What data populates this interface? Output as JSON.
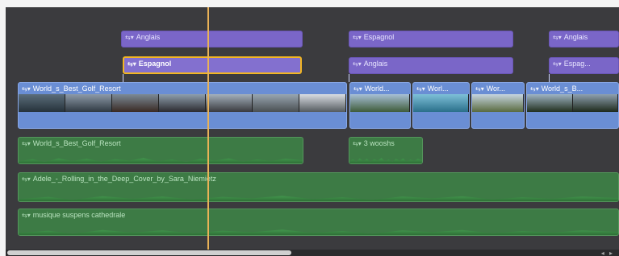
{
  "timeline": {
    "title_clips_row1": [
      {
        "label": "Anglais"
      },
      {
        "label": "Espagnol"
      },
      {
        "label": "Anglais"
      }
    ],
    "title_clips_row2": [
      {
        "label": "Espagnol",
        "selected": true
      },
      {
        "label": "Anglais"
      },
      {
        "label": "Espag..."
      }
    ],
    "video_clips": [
      {
        "label": "World_s_Best_Golf_Resort"
      },
      {
        "label": "World..."
      },
      {
        "label": "Worl..."
      },
      {
        "label": "Wor..."
      },
      {
        "label": "World_s_B..."
      }
    ],
    "audio_clips": [
      {
        "label": "World_s_Best_Golf_Resort"
      },
      {
        "label": "3 wooshs"
      },
      {
        "label": "Adele_-_Rolling_in_the_Deep_Cover_by_Sara_Niemietz"
      },
      {
        "label": "musique suspens cathedrale"
      }
    ]
  },
  "colors": {
    "title_clip": "#7a66c8",
    "selected_border": "#f2b623",
    "video_clip": "#6a8ed4",
    "audio_clip": "#3d7b45",
    "playhead": "#e9b257",
    "background": "#3b3b3e"
  },
  "icons": {
    "clip_menu": "clip-menu-icon",
    "zoom": "zoom-arrows-icon"
  }
}
